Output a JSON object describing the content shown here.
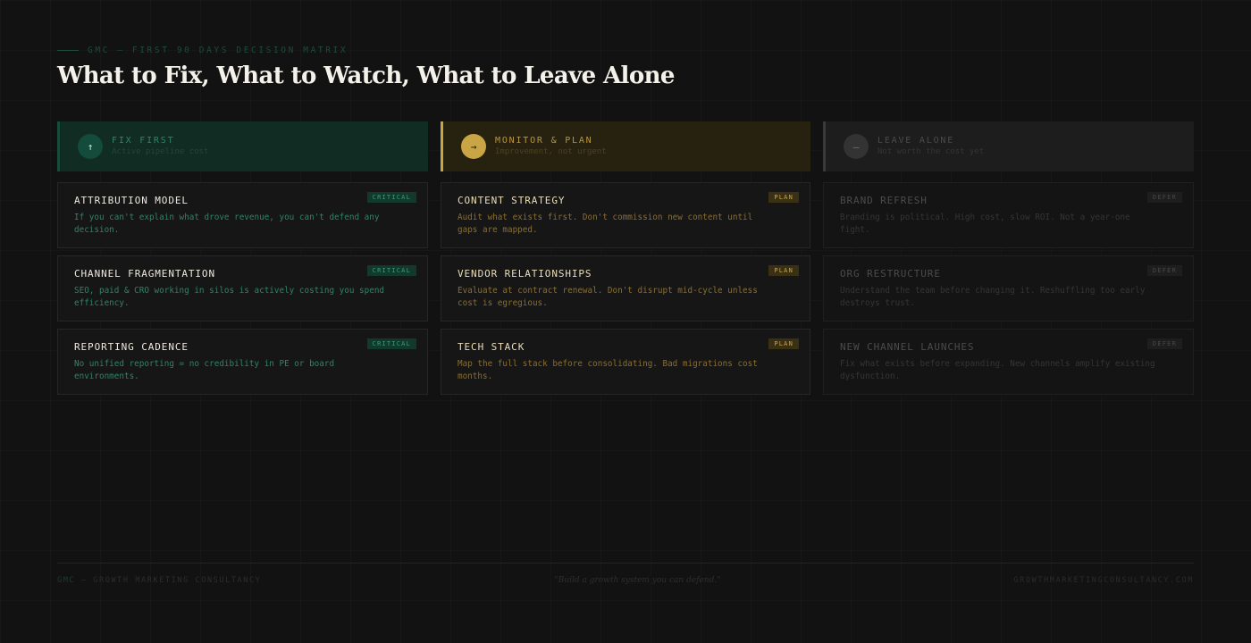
{
  "header": {
    "eyebrow": "GMC — FIRST 90 DAYS DECISION MATRIX",
    "title": "What to Fix, What to Watch, What to Leave Alone"
  },
  "columns": [
    {
      "key": "fix",
      "icon": "↑",
      "icon_name": "arrow-up-icon",
      "title": "FIX FIRST",
      "subtitle": "Active pipeline cost",
      "accent": "#2f8566",
      "cards": [
        {
          "title": "ATTRIBUTION MODEL",
          "badge": "CRITICAL",
          "desc": "If you can't explain what drove revenue, you can't defend any decision."
        },
        {
          "title": "CHANNEL FRAGMENTATION",
          "badge": "CRITICAL",
          "desc": "SEO, paid & CRO working in silos is actively costing you spend efficiency."
        },
        {
          "title": "REPORTING CADENCE",
          "badge": "CRITICAL",
          "desc": "No unified reporting = no credibility in PE or board environments."
        }
      ]
    },
    {
      "key": "mon",
      "icon": "→",
      "icon_name": "arrow-right-icon",
      "title": "MONITOR & PLAN",
      "subtitle": "Improvement, not urgent",
      "accent": "#c9a545",
      "cards": [
        {
          "title": "CONTENT STRATEGY",
          "badge": "PLAN",
          "desc": "Audit what exists first. Don't commission new content until gaps are mapped."
        },
        {
          "title": "VENDOR RELATIONSHIPS",
          "badge": "PLAN",
          "desc": "Evaluate at contract renewal. Don't disrupt mid-cycle unless cost is egregious."
        },
        {
          "title": "TECH STACK",
          "badge": "PLAN",
          "desc": "Map the full stack before consolidating. Bad migrations cost months."
        }
      ]
    },
    {
      "key": "leave",
      "icon": "—",
      "icon_name": "dash-icon",
      "title": "LEAVE ALONE",
      "subtitle": "Not worth the cost yet",
      "accent": "#3a3a3a",
      "cards": [
        {
          "title": "BRAND REFRESH",
          "badge": "DEFER",
          "desc": "Branding is political. High cost, slow ROI. Not a year-one fight."
        },
        {
          "title": "ORG RESTRUCTURE",
          "badge": "DEFER",
          "desc": "Understand the team before changing it. Reshuffling too early destroys trust."
        },
        {
          "title": "NEW CHANNEL LAUNCHES",
          "badge": "DEFER",
          "desc": "Fix what exists before expanding. New channels amplify existing dysfunction."
        }
      ]
    }
  ],
  "footer": {
    "left_brand": "GMC",
    "left_rest": " — GROWTH MARKETING CONSULTANCY",
    "quote": "\"Build a growth system you can defend.\"",
    "right": "GROWTHMARKETINGCONSULTANCY.COM"
  }
}
